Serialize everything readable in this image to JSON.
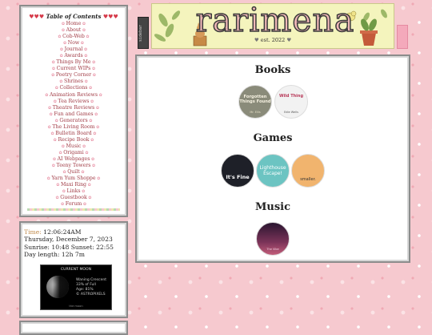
{
  "toc": {
    "title": "Table of Contents",
    "hearts": "♥♥♥",
    "items": [
      "Home",
      "About",
      "Cob-Web",
      "Now",
      "Journal",
      "Awards",
      "Things By Me",
      "Current WIPs",
      "Poetry Corner",
      "Shrines",
      "Collections",
      "Animation Reviews",
      "Tea Reviews",
      "Theatre Reviews",
      "Fun and Games",
      "Generators",
      "The Living Room",
      "Bulletin Board",
      "Recipe Book",
      "Music",
      "Origami",
      "AI Webpages",
      "Teeny Towers",
      "Quilt",
      "Yarn Yum Shoppe",
      "Maxi Ring",
      "Links",
      "Guestbook",
      "Forum"
    ]
  },
  "time": {
    "label": "Time:",
    "clock": "12:06:24AM",
    "date": "Thursday, December 7, 2023",
    "sun": "Sunrise: 10:48 Sunset: 22:55",
    "daylength": "Day length: 12h 7m"
  },
  "moon": {
    "caption": "CURRENT MOON",
    "phase": "Waning Crescent",
    "full": "33% of Full",
    "age": "Age: 81%",
    "source": "© ASTROPIXELS",
    "foot": "the moon"
  },
  "sidebar_tab": "sidebar",
  "banner": {
    "logo": "rarimena",
    "est": "est. 2022",
    "heart": "♥"
  },
  "sections": {
    "books": "Books",
    "games": "Games",
    "music": "Music"
  },
  "books": [
    {
      "name": "Forgotten Things Found",
      "sub": "Mr. Ellis"
    },
    {
      "name": "Wild Thing",
      "sub": "Edie Wells"
    }
  ],
  "games": [
    {
      "name": "It's Fine"
    },
    {
      "name": "Lighthouse Escape!"
    },
    {
      "name": "smaller."
    }
  ],
  "music": [
    {
      "name": "The Vibe"
    }
  ]
}
